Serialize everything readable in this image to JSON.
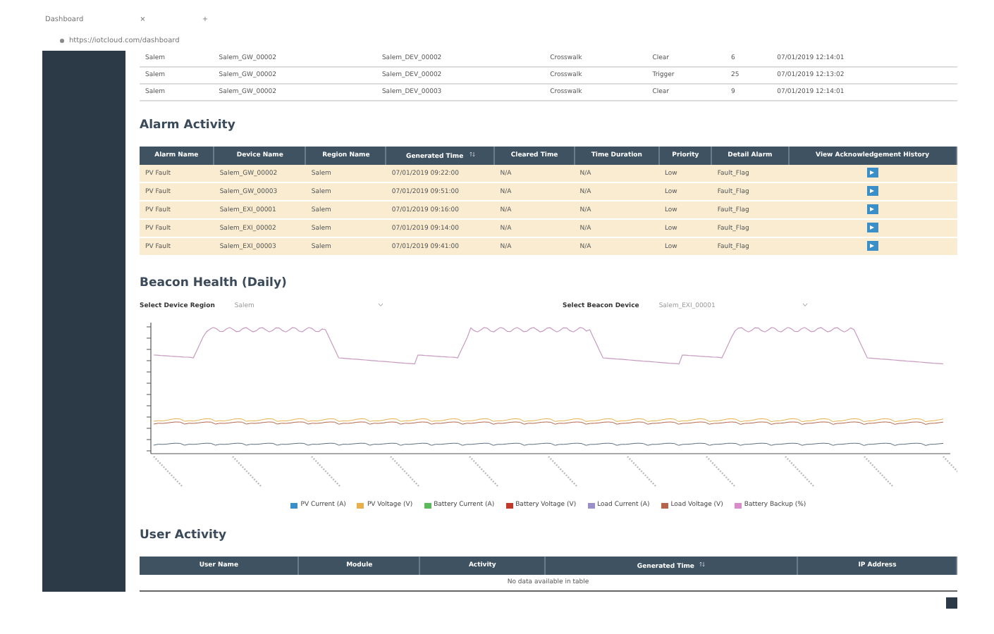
{
  "browser": {
    "tab_title": "Dashboard",
    "tab_close": "×",
    "new_tab": "+",
    "url": "https://iotcloud.com/dashboard"
  },
  "device_table": {
    "rows": [
      [
        "Salem",
        "Salem_GW_00002",
        "Salem_DEV_00002",
        "Crosswalk",
        "Clear",
        "6",
        "07/01/2019 12:14:01"
      ],
      [
        "Salem",
        "Salem_GW_00002",
        "Salem_DEV_00002",
        "Crosswalk",
        "Trigger",
        "25",
        "07/01/2019 12:13:02"
      ],
      [
        "Salem",
        "Salem_GW_00002",
        "Salem_DEV_00003",
        "Crosswalk",
        "Clear",
        "9",
        "07/01/2019 12:14:01"
      ]
    ]
  },
  "alarm_activity": {
    "title": "Alarm Activity",
    "columns": [
      {
        "label": "Alarm Name",
        "sortable": false
      },
      {
        "label": "Device Name",
        "sortable": false
      },
      {
        "label": "Region Name",
        "sortable": false
      },
      {
        "label": "Generated Time",
        "sortable": true
      },
      {
        "label": "Cleared Time",
        "sortable": false
      },
      {
        "label": "Time Duration",
        "sortable": false
      },
      {
        "label": "Priority",
        "sortable": false
      },
      {
        "label": "Detail Alarm",
        "sortable": false
      },
      {
        "label": "View Acknowledgement History",
        "sortable": false
      }
    ],
    "rows": [
      [
        "PV Fault",
        "Salem_GW_00002",
        "Salem",
        "07/01/2019 09:22:00",
        "N/A",
        "N/A",
        "Low",
        "Fault_Flag"
      ],
      [
        "PV Fault",
        "Salem_GW_00003",
        "Salem",
        "07/01/2019 09:51:00",
        "N/A",
        "N/A",
        "Low",
        "Fault_Flag"
      ],
      [
        "PV Fault",
        "Salem_EXI_00001",
        "Salem",
        "07/01/2019 09:16:00",
        "N/A",
        "N/A",
        "Low",
        "Fault_Flag"
      ],
      [
        "PV Fault",
        "Salem_EXI_00002",
        "Salem",
        "07/01/2019 09:14:00",
        "N/A",
        "N/A",
        "Low",
        "Fault_Flag"
      ],
      [
        "PV Fault",
        "Salem_EXI_00003",
        "Salem",
        "07/01/2019 09:41:00",
        "N/A",
        "N/A",
        "Low",
        "Fault_Flag"
      ]
    ]
  },
  "beacon_health": {
    "title": "Beacon Health (Daily)",
    "filters": [
      {
        "label": "Select Device Region",
        "value": "Salem"
      },
      {
        "label": "Select Beacon Device",
        "value": "Salem_EXI_00001"
      }
    ],
    "legend": [
      {
        "label": "PV Current (A)",
        "color": "#3a8fc8"
      },
      {
        "label": "PV Voltage (V)",
        "color": "#e8b04a"
      },
      {
        "label": "Battery Current (A)",
        "color": "#5cb85c"
      },
      {
        "label": "Battery Voltage (V)",
        "color": "#c0392b"
      },
      {
        "label": "Load Current (A)",
        "color": "#9b8fc9"
      },
      {
        "label": "Load Voltage (V)",
        "color": "#b5654a"
      },
      {
        "label": "Battery Backup (%)",
        "color": "#d98cc8"
      }
    ]
  },
  "user_activity": {
    "title": "User Activity",
    "columns": [
      {
        "label": "User Name",
        "sortable": false
      },
      {
        "label": "Module",
        "sortable": false
      },
      {
        "label": "Activity",
        "sortable": false
      },
      {
        "label": "Generated Time",
        "sortable": true
      },
      {
        "label": "IP Address",
        "sortable": false
      }
    ],
    "empty_message": "No data available in table"
  }
}
